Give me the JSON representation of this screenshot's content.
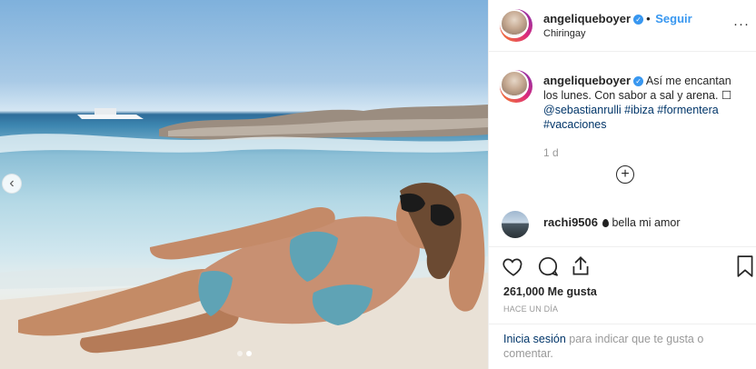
{
  "header": {
    "username": "angeliqueboyer",
    "bullet": "•",
    "follow_label": "Seguir",
    "location": "Chiringay",
    "more_label": "···"
  },
  "caption": {
    "username": "angeliqueboyer",
    "text": "Así me encantan los lunes. Con sabor a sal y arena.",
    "symbol": "☐",
    "mention": "@sebastianrulli",
    "hashtags": [
      "#ibiza",
      "#formentera",
      "#vacaciones"
    ],
    "age": "1 d",
    "load_more_label": "+"
  },
  "comment": {
    "username": "rachi9506",
    "text": "bella mi amor"
  },
  "actions": {
    "likes": "261,000 Me gusta",
    "time": "HACE UN DÍA"
  },
  "login": {
    "link_label": "Inicia sesión",
    "rest": "para indicar que te gusta o comentar."
  },
  "carousel": {
    "prev_icon": "‹",
    "slide_count": 2,
    "active_index": 1
  },
  "icons": {
    "header_verified": "verified-badge-icon",
    "like": "heart-icon",
    "comment": "comment-bubble-icon",
    "share": "share-icon",
    "save": "bookmark-icon"
  },
  "colors": {
    "accent": "#3897f0",
    "link": "#003569",
    "muted": "#999999",
    "text": "#262626"
  }
}
